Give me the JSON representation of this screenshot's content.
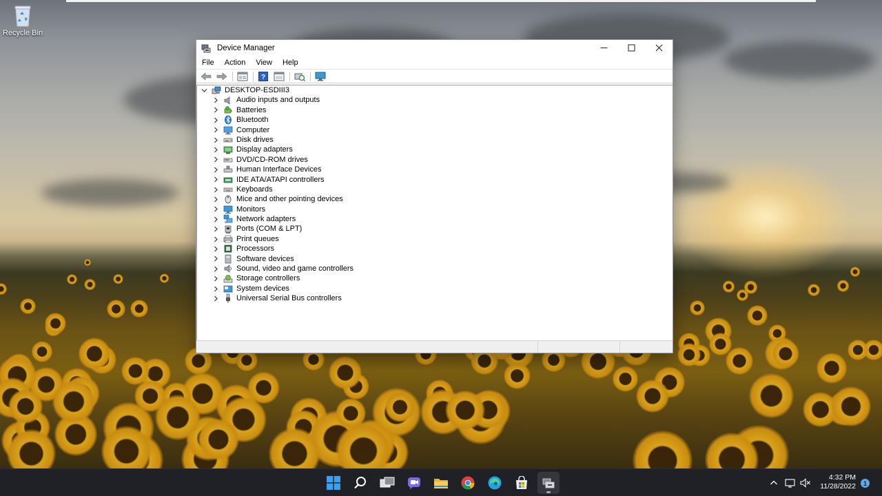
{
  "desktop": {
    "recycle_bin_label": "Recycle Bin",
    "recycle_bin_icon": "recycle-bin-icon"
  },
  "window": {
    "title": "Device Manager",
    "app_icon": "device-manager-icon",
    "controls": {
      "minimize": "—",
      "maximize": "☐",
      "close": "✕"
    },
    "menu": [
      "File",
      "Action",
      "View",
      "Help"
    ],
    "toolbar_icons": [
      "back-icon",
      "forward-icon",
      "properties-icon",
      "help-icon",
      "update-driver-icon",
      "scan-hardware-icon",
      "monitor-icon"
    ],
    "tree": {
      "root": "DESKTOP-ESDIII3",
      "items": [
        {
          "label": "Audio inputs and outputs",
          "icon": "speaker-icon"
        },
        {
          "label": "Batteries",
          "icon": "battery-icon"
        },
        {
          "label": "Bluetooth",
          "icon": "bluetooth-icon"
        },
        {
          "label": "Computer",
          "icon": "computer-icon"
        },
        {
          "label": "Disk drives",
          "icon": "disk-drive-icon"
        },
        {
          "label": "Display adapters",
          "icon": "display-adapter-icon"
        },
        {
          "label": "DVD/CD-ROM drives",
          "icon": "dvd-drive-icon"
        },
        {
          "label": "Human Interface Devices",
          "icon": "hid-icon"
        },
        {
          "label": "IDE ATA/ATAPI controllers",
          "icon": "ide-controller-icon"
        },
        {
          "label": "Keyboards",
          "icon": "keyboard-icon"
        },
        {
          "label": "Mice and other pointing devices",
          "icon": "mouse-icon"
        },
        {
          "label": "Monitors",
          "icon": "monitor-icon"
        },
        {
          "label": "Network adapters",
          "icon": "network-adapter-icon"
        },
        {
          "label": "Ports (COM & LPT)",
          "icon": "port-icon"
        },
        {
          "label": "Print queues",
          "icon": "printer-icon"
        },
        {
          "label": "Processors",
          "icon": "processor-icon"
        },
        {
          "label": "Software devices",
          "icon": "software-device-icon"
        },
        {
          "label": "Sound, video and game controllers",
          "icon": "sound-controller-icon"
        },
        {
          "label": "Storage controllers",
          "icon": "storage-controller-icon"
        },
        {
          "label": "System devices",
          "icon": "system-device-icon"
        },
        {
          "label": "Universal Serial Bus controllers",
          "icon": "usb-icon"
        }
      ]
    }
  },
  "taskbar": {
    "apps": [
      "start-icon",
      "search-icon",
      "task-view-icon",
      "chat-icon",
      "file-explorer-icon",
      "chrome-icon",
      "edge-icon",
      "store-icon",
      "device-manager-icon"
    ],
    "active_app": "device-manager-icon",
    "tray": [
      "chevron-up-icon",
      "network-icon",
      "volume-muted-icon"
    ],
    "time": "4:32 PM",
    "date": "11/28/2022",
    "notification_count": "1"
  },
  "colors": {
    "taskbar_bg": "#1f2126",
    "window_bg": "#ffffff",
    "accent_blue": "#2f7fd8"
  }
}
